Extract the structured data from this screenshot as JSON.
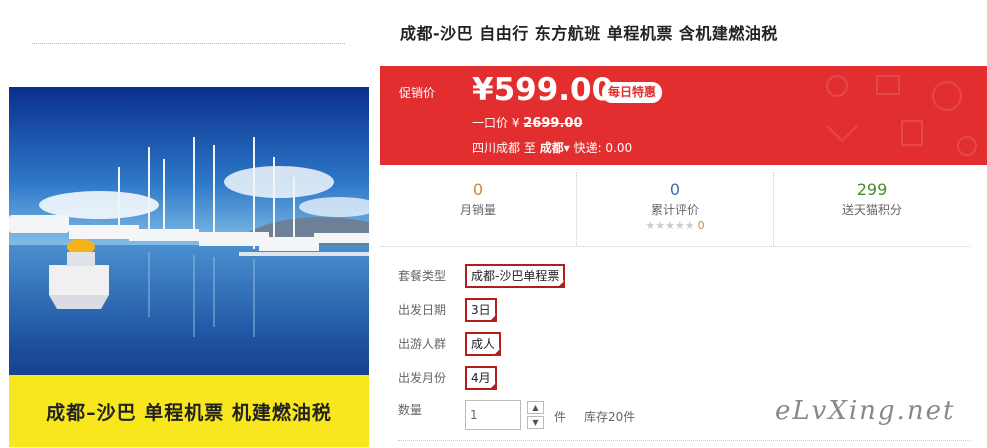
{
  "product": {
    "title": "成都-沙巴 自由行 东方航班 单程机票 含机建燃油税",
    "image_caption": "成都–沙巴  单程机票 机建燃油税"
  },
  "promo": {
    "label": "促销价",
    "price": "¥599.00",
    "badge": "每日特惠",
    "original_label": "一口价 ¥",
    "original_price": "2699.00",
    "from": "四川成都",
    "to_word": "至",
    "to": "成都",
    "shipping": "快递: 0.00"
  },
  "stats": [
    {
      "value": "0",
      "label": "月销量"
    },
    {
      "value": "0",
      "label": "累计评价",
      "stars": "★★★★★",
      "review_count": "0"
    },
    {
      "value": "299",
      "label": "送天猫积分"
    }
  ],
  "options": [
    {
      "label": "套餐类型",
      "value": "成都-沙巴单程票"
    },
    {
      "label": "出发日期",
      "value": "3日"
    },
    {
      "label": "出游人群",
      "value": "成人"
    },
    {
      "label": "出发月份",
      "value": "4月"
    }
  ],
  "quantity": {
    "label": "数量",
    "value": "1",
    "unit": "件",
    "stock": "库存20件"
  },
  "watermark": "eLvXing.net",
  "colors": {
    "promo_bg": "#e22e2e",
    "selected_border": "#b01e1e",
    "caption_bg": "#f8e71c",
    "sold_color": "#c98a3a",
    "reviews_color": "#3b6ca8",
    "points_color": "#4a8a2a"
  },
  "icons": [
    "chevron-down-icon",
    "arrow-up-icon",
    "arrow-down-icon",
    "star-icon",
    "check-icon"
  ]
}
